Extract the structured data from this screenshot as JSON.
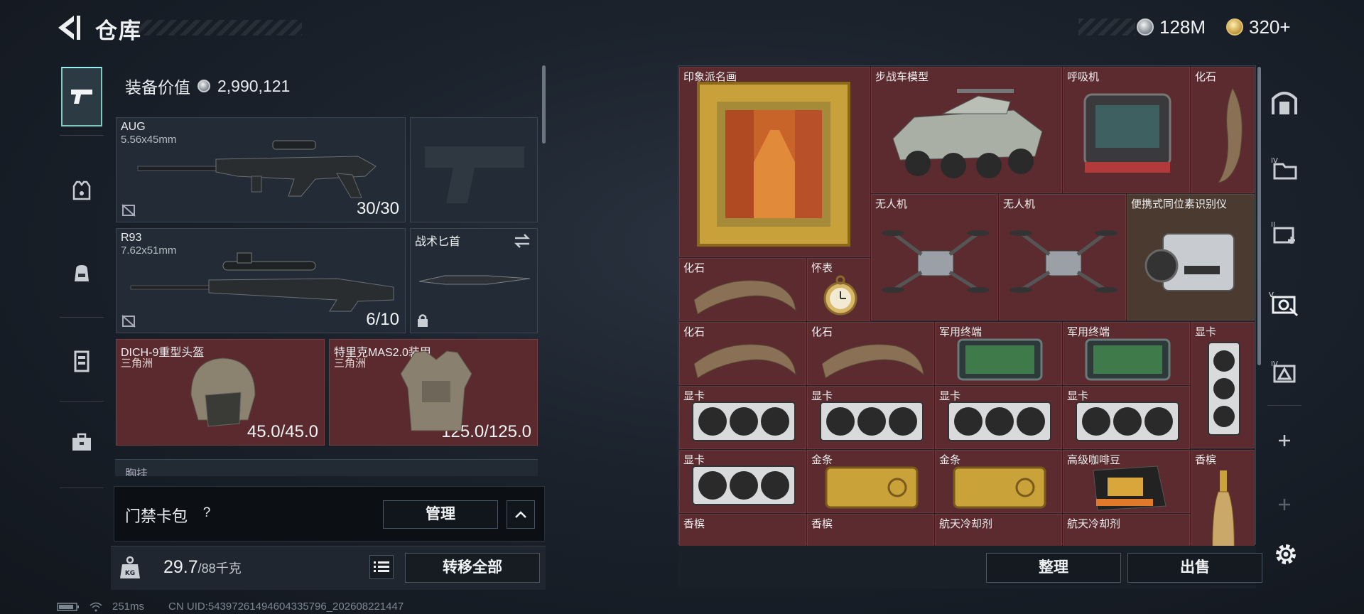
{
  "header": {
    "title": "仓库",
    "currencies": [
      {
        "icon": "silver-coin-icon",
        "amount": "128M"
      },
      {
        "icon": "gold-coin-icon",
        "amount": "320+"
      }
    ]
  },
  "equipment": {
    "value_label": "装备价值",
    "value": "2,990,121",
    "primary": {
      "name": "AUG",
      "caliber": "5.56x45mm",
      "ammo": "30/30"
    },
    "secondary": {
      "name": "R93",
      "caliber": "7.62x51mm",
      "ammo": "6/10"
    },
    "melee": {
      "name": "战术匕首"
    },
    "helmet": {
      "name": "DICH-9重型头盔",
      "origin": "三角洲",
      "durability": "45.0/45.0"
    },
    "armor": {
      "name": "特里克MAS2.0装甲",
      "origin": "三角洲",
      "durability": "125.0/125.0"
    },
    "next_slot": "胸挂"
  },
  "card_pack": {
    "label": "门禁卡包",
    "help": "?",
    "manage_label": "管理"
  },
  "weight": {
    "current": "29.7",
    "max": "/88千克",
    "transfer_all_label": "转移全部"
  },
  "status_bar": {
    "ping": "251ms",
    "uid": "CN UID:54397261494604335796_202608221447"
  },
  "stash": {
    "items": [
      {
        "label": "印象派名画"
      },
      {
        "label": "步战车模型"
      },
      {
        "label": "呼吸机"
      },
      {
        "label": "化石"
      },
      {
        "label": "无人机"
      },
      {
        "label": "无人机"
      },
      {
        "label": "便携式同位素识别仪"
      },
      {
        "label": "化石"
      },
      {
        "label": "怀表"
      },
      {
        "label": "化石"
      },
      {
        "label": "化石"
      },
      {
        "label": "军用终端"
      },
      {
        "label": "军用终端"
      },
      {
        "label": "显卡"
      },
      {
        "label": "显卡"
      },
      {
        "label": "显卡"
      },
      {
        "label": "显卡"
      },
      {
        "label": "显卡"
      },
      {
        "label": "显卡"
      },
      {
        "label": "金条"
      },
      {
        "label": "金条"
      },
      {
        "label": "高级咖啡豆"
      },
      {
        "label": "香槟"
      },
      {
        "label": "香槟"
      },
      {
        "label": "香槟"
      },
      {
        "label": "航天冷却剂"
      },
      {
        "label": "航天冷却剂"
      }
    ],
    "sort_label": "整理",
    "sell_label": "出售"
  }
}
